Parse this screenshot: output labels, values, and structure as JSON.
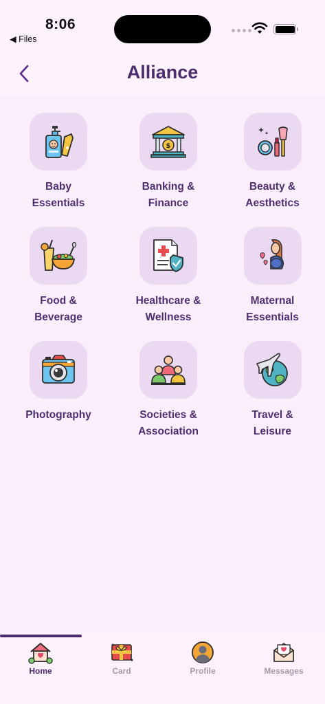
{
  "status_bar": {
    "time": "8:06",
    "back_app": "◀ Files"
  },
  "header": {
    "title": "Alliance"
  },
  "categories": [
    {
      "label": "Baby\nEssentials",
      "icon": "baby-bottle-icon"
    },
    {
      "label": "Banking &\nFinance",
      "icon": "bank-icon"
    },
    {
      "label": "Beauty &\nAesthetics",
      "icon": "makeup-icon"
    },
    {
      "label": "Food &\nBeverage",
      "icon": "food-icon"
    },
    {
      "label": "Healthcare &\nWellness",
      "icon": "health-document-icon"
    },
    {
      "label": "Maternal\nEssentials",
      "icon": "pregnant-woman-icon"
    },
    {
      "label": "Photography",
      "icon": "camera-icon"
    },
    {
      "label": "Societies &\nAssociation",
      "icon": "people-group-icon"
    },
    {
      "label": "Travel &\nLeisure",
      "icon": "plane-globe-icon"
    }
  ],
  "tabs": [
    {
      "label": "Home",
      "icon": "home-heart-icon",
      "active": true
    },
    {
      "label": "Card",
      "icon": "gift-card-icon",
      "active": false
    },
    {
      "label": "Profile",
      "icon": "profile-icon",
      "active": false
    },
    {
      "label": "Messages",
      "icon": "envelope-heart-icon",
      "active": false
    }
  ]
}
